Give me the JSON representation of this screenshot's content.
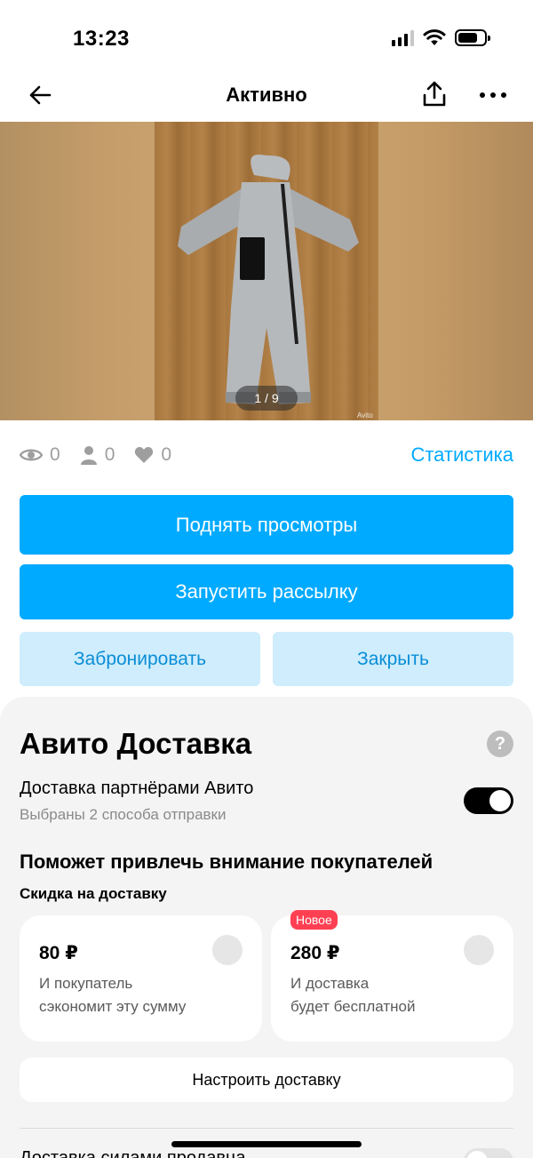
{
  "status_bar": {
    "time": "13:23",
    "battery_level": 0.74
  },
  "nav": {
    "title": "Активно",
    "back_icon": "arrow-left-icon",
    "share_icon": "share-icon",
    "more_icon": "more-icon"
  },
  "gallery": {
    "counter": "1 / 9",
    "watermark": "Avito"
  },
  "stats": {
    "views": "0",
    "contacts": "0",
    "favorites": "0",
    "link_label": "Статистика",
    "icon_color": "#9e9e9e",
    "link_color": "#00aaff"
  },
  "actions": {
    "raise_views": "Поднять просмотры",
    "mailing": "Запустить рассылку",
    "reserve": "Забронировать",
    "close": "Закрыть",
    "primary_color": "#00aaff",
    "secondary_color": "#cfedfd"
  },
  "delivery": {
    "title": "Авито Доставка",
    "help": "?",
    "partner_title": "Доставка партнёрами Авито",
    "partner_subtitle": "Выбраны 2 способа отправки",
    "partner_enabled": true,
    "attract_title": "Поможет привлечь внимание покупателей",
    "discount_label": "Скидка на доставку",
    "options": [
      {
        "price": "80 ₽",
        "desc_line1": "И покупатель",
        "desc_line2": "сэкономит эту сумму",
        "badge": ""
      },
      {
        "price": "280 ₽",
        "desc_line1": "И доставка",
        "desc_line2": "будет бесплатной",
        "badge": "Новое"
      }
    ],
    "configure_label": "Настроить доставку",
    "cutoff_label": "Доставка силами продавца",
    "badge_color": "#ff4053"
  }
}
